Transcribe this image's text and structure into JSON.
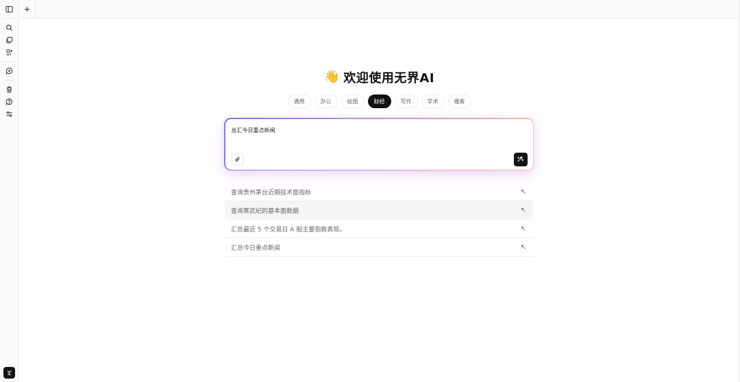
{
  "icons": {
    "sidebar_toggle": "sidebar-toggle-icon",
    "new_tab": "plus-icon",
    "search": "search-icon",
    "copy": "copy-icon",
    "apps": "apps-icon",
    "add_chat": "add-chat-icon",
    "trash": "trash-icon",
    "help": "help-icon",
    "settings": "sliders-icon",
    "attach": "paperclip-icon",
    "send": "sparkle-icon",
    "suggestion_arrow": "arrow-up-left-icon"
  },
  "greeting": {
    "emoji": "👋",
    "title": "欢迎使用无界AI"
  },
  "categories": [
    {
      "label": "通用",
      "active": false
    },
    {
      "label": "办公",
      "active": false
    },
    {
      "label": "绘图",
      "active": false
    },
    {
      "label": "财经",
      "active": true
    },
    {
      "label": "写作",
      "active": false
    },
    {
      "label": "学术",
      "active": false
    },
    {
      "label": "播客",
      "active": false
    }
  ],
  "prompt": {
    "value": "总汇今日重点新闻"
  },
  "suggestions": [
    {
      "text": "查询贵州茅台近期技术面指标"
    },
    {
      "text": "查询寒武纪的基本面数据"
    },
    {
      "text": "汇总最近 5 个交易日 A 股主要指数表现。"
    },
    {
      "text": "汇总今日重点新闻"
    }
  ],
  "colors": {
    "accent": "#111111",
    "gradient_start": "#7b7bf0",
    "gradient_end": "#f7c690",
    "rail_bg": "#fafafa"
  }
}
